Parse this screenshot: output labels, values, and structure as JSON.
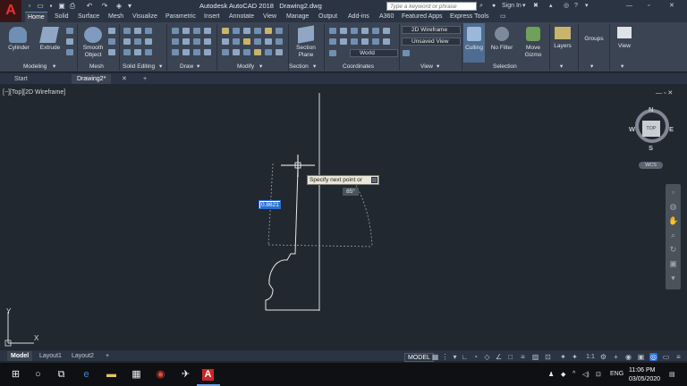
{
  "title_bar": {
    "app_title": "Autodesk AutoCAD 2018",
    "file_name": "Drawing2.dwg",
    "search_placeholder": "Type a keyword or phrase",
    "sign_in": "Sign In"
  },
  "ribbon_tabs": [
    "Home",
    "Solid",
    "Surface",
    "Mesh",
    "Visualize",
    "Parametric",
    "Insert",
    "Annotate",
    "View",
    "Manage",
    "Output",
    "Add-ins",
    "A360",
    "Featured Apps",
    "Express Tools"
  ],
  "ribbon": {
    "cylinder": "Cylinder",
    "extrude": "Extrude",
    "smooth_object_1": "Smooth",
    "smooth_object_2": "Object",
    "section_plane_1": "Section",
    "section_plane_2": "Plane",
    "visual_style": "2D Wireframe",
    "view_name": "Unsaved View",
    "ucs": "World",
    "culling": "Culling",
    "no_filter": "No Filter",
    "move_gizmo_1": "Move",
    "move_gizmo_2": "Gizmo",
    "layers": "Layers",
    "groups": "Groups",
    "view": "View",
    "panels": {
      "modeling": "Modeling",
      "mesh": "Mesh",
      "solid_editing": "Solid Editing",
      "draw": "Draw",
      "modify": "Modify",
      "section": "Section",
      "coordinates": "Coordinates",
      "view": "View",
      "selection": "Selection"
    }
  },
  "doc_tabs": {
    "start": "Start",
    "drawing": "Drawing2*"
  },
  "viewport": {
    "label": "[−][Top][2D Wireframe]",
    "tooltip": "Specify next point or",
    "length_value": "0.8621",
    "angle_value": "85°",
    "viewcube_top": "TOP",
    "compass_n": "N",
    "compass_s": "S",
    "compass_e": "E",
    "compass_w": "W",
    "wcs": "WCS",
    "ucs_y": "Y",
    "ucs_x": "X"
  },
  "layout_tabs": [
    "Model",
    "Layout1",
    "Layout2"
  ],
  "status_bar": {
    "model": "MODEL",
    "scale": "1:1"
  },
  "taskbar": {
    "language": "ENG",
    "time": "11:06 PM",
    "date": "03/05/2020"
  },
  "colors": {
    "canvas": "#212830",
    "ribbon": "#3b4453",
    "accent": "#2a6fd6",
    "brand_red": "#e8322f"
  }
}
